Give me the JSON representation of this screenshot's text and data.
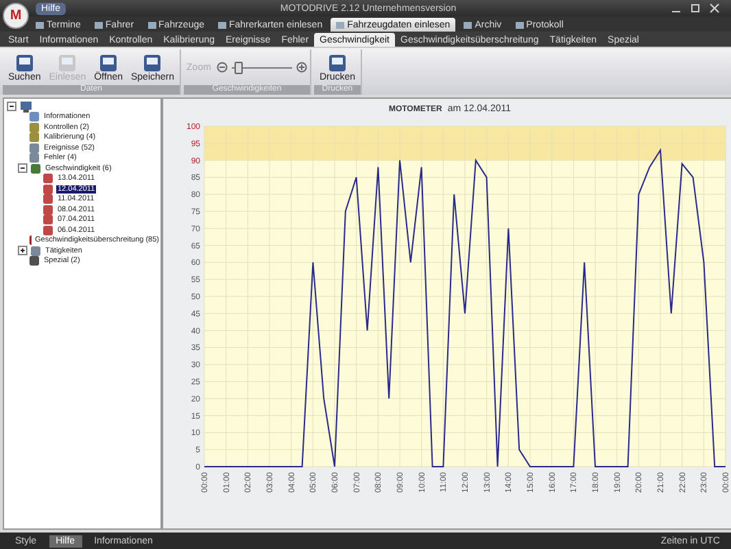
{
  "window": {
    "logo": "M",
    "title": "MOTODRIVE 2.12 Unternehmensversion",
    "help": "Hilfe"
  },
  "app_tabs": [
    {
      "label": "Termine",
      "selected": false
    },
    {
      "label": "Fahrer",
      "selected": false
    },
    {
      "label": "Fahrzeuge",
      "selected": false
    },
    {
      "label": "Fahrerkarten einlesen",
      "selected": false
    },
    {
      "label": "Fahrzeugdaten einlesen",
      "selected": true
    },
    {
      "label": "Archiv",
      "selected": false
    },
    {
      "label": "Protokoll",
      "selected": false
    }
  ],
  "ribbon_tabs": [
    {
      "label": "Start",
      "selected": false
    },
    {
      "label": "Informationen",
      "selected": false
    },
    {
      "label": "Kontrollen",
      "selected": false
    },
    {
      "label": "Kalibrierung",
      "selected": false
    },
    {
      "label": "Ereignisse",
      "selected": false
    },
    {
      "label": "Fehler",
      "selected": false
    },
    {
      "label": "Geschwindigkeit",
      "selected": true
    },
    {
      "label": "Geschwindigkeitsüberschreitung",
      "selected": false
    },
    {
      "label": "Tätigkeiten",
      "selected": false
    },
    {
      "label": "Spezial",
      "selected": false
    }
  ],
  "ribbon_groups": [
    {
      "label": "Daten",
      "kind": "buttons",
      "buttons": [
        {
          "label": "Suchen",
          "disabled": false
        },
        {
          "label": "Einlesen",
          "disabled": true
        },
        {
          "label": "Öffnen",
          "disabled": false
        },
        {
          "label": "Speichern",
          "disabled": false
        }
      ]
    },
    {
      "label": "Geschwindigkeiten",
      "kind": "zoom",
      "zoom_label": "Zoom",
      "level": 0.1
    },
    {
      "label": "Drucken",
      "kind": "buttons",
      "buttons": [
        {
          "label": "Drucken",
          "disabled": false
        }
      ]
    }
  ],
  "tree": {
    "expanded": true,
    "children": [
      {
        "label": "Informationen",
        "kind": "info"
      },
      {
        "label": "Kontrollen (2)",
        "kind": "person"
      },
      {
        "label": "Kalibrierung (4)",
        "kind": "person"
      },
      {
        "label": "Ereignisse (52)",
        "kind": "car"
      },
      {
        "label": "Fehler (4)",
        "kind": "car"
      },
      {
        "label": "Geschwindigkeit (6)",
        "kind": "gauge",
        "expanded": true,
        "children": [
          {
            "label": "13.04.2011",
            "kind": "doc",
            "selected": false
          },
          {
            "label": "12.04.2011",
            "kind": "doc",
            "selected": true
          },
          {
            "label": "11.04.2011",
            "kind": "doc",
            "selected": false
          },
          {
            "label": "08.04.2011",
            "kind": "doc",
            "selected": false
          },
          {
            "label": "07.04.2011",
            "kind": "doc",
            "selected": false
          },
          {
            "label": "06.04.2011",
            "kind": "doc",
            "selected": false
          }
        ]
      },
      {
        "label": "Geschwindigkeitsüberschreitung (85)",
        "kind": "alert"
      },
      {
        "label": "Tätigkeiten",
        "kind": "car",
        "expanded": false
      },
      {
        "label": "Spezial (2)",
        "kind": "tool"
      }
    ]
  },
  "chart": {
    "title": "MOTOMETER",
    "date": "am 12.04.2011",
    "chart_data": {
      "type": "line",
      "ylim": [
        0,
        100
      ],
      "xlim": [
        0,
        24
      ],
      "yticks": [
        0,
        5,
        10,
        15,
        20,
        25,
        30,
        35,
        40,
        45,
        50,
        55,
        60,
        65,
        70,
        75,
        80,
        85,
        90,
        95,
        100
      ],
      "xticks": [
        {
          "value": 0,
          "label": "00:00"
        },
        {
          "value": 1,
          "label": "01:00"
        },
        {
          "value": 2,
          "label": "02:00"
        },
        {
          "value": 3,
          "label": "03:00"
        },
        {
          "value": 4,
          "label": "04:00"
        },
        {
          "value": 5,
          "label": "05:00"
        },
        {
          "value": 6,
          "label": "06:00"
        },
        {
          "value": 7,
          "label": "07:00"
        },
        {
          "value": 8,
          "label": "08:00"
        },
        {
          "value": 9,
          "label": "09:00"
        },
        {
          "value": 10,
          "label": "10:00"
        },
        {
          "value": 11,
          "label": "11:00"
        },
        {
          "value": 12,
          "label": "12:00"
        },
        {
          "value": 13,
          "label": "13:00"
        },
        {
          "value": 14,
          "label": "14:00"
        },
        {
          "value": 15,
          "label": "15:00"
        },
        {
          "value": 16,
          "label": "16:00"
        },
        {
          "value": 17,
          "label": "17:00"
        },
        {
          "value": 18,
          "label": "18:00"
        },
        {
          "value": 19,
          "label": "19:00"
        },
        {
          "value": 20,
          "label": "20:00"
        },
        {
          "value": 21,
          "label": "21:00"
        },
        {
          "value": 22,
          "label": "22:00"
        },
        {
          "value": 23,
          "label": "23:00"
        },
        {
          "value": 24,
          "label": "00:00"
        }
      ],
      "x": [
        0,
        0.5,
        1,
        1.5,
        2,
        2.5,
        3,
        3.5,
        4,
        4.5,
        5,
        5.5,
        6,
        6.5,
        7,
        7.5,
        8,
        8.5,
        9,
        9.5,
        10,
        10.5,
        11,
        11.5,
        12,
        12.5,
        13,
        13.5,
        14,
        14.5,
        15,
        15.5,
        16,
        16.5,
        17,
        17.5,
        18,
        18.5,
        19,
        19.5,
        20,
        20.5,
        21,
        21.5,
        22,
        22.5,
        23,
        23.5,
        24
      ],
      "series": [
        {
          "color": "#2a2a8c",
          "values": [
            0,
            0,
            0,
            0,
            0,
            0,
            0,
            0,
            0,
            0,
            60,
            20,
            0,
            75,
            85,
            40,
            88,
            20,
            90,
            60,
            88,
            0,
            0,
            80,
            45,
            90,
            85,
            0,
            70,
            5,
            0,
            0,
            0,
            0,
            0,
            60,
            0,
            0,
            0,
            0,
            80,
            88,
            93,
            45,
            89,
            85,
            60,
            0,
            0
          ]
        }
      ],
      "grid": true,
      "bands": [
        {
          "axis": "y",
          "from": 90,
          "to": 100
        }
      ]
    }
  },
  "status_bar": {
    "items": [
      {
        "label": "Style",
        "selected": false
      },
      {
        "label": "Hilfe",
        "selected": true
      },
      {
        "label": "Informationen",
        "selected": false
      }
    ],
    "right": "Zeiten in UTC"
  }
}
